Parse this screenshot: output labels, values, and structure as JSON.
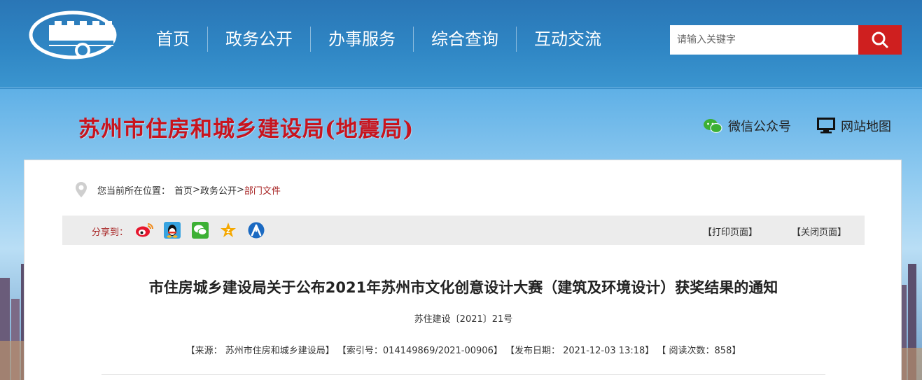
{
  "nav": {
    "items": [
      "首页",
      "政务公开",
      "办事服务",
      "综合查询",
      "互动交流"
    ]
  },
  "search": {
    "placeholder": "请输入关键字"
  },
  "site": {
    "title": "苏州市住房和城乡建设局(地震局)"
  },
  "quick_links": {
    "wechat": "微信公众号",
    "sitemap": "网站地图"
  },
  "breadcrumb": {
    "prefix": "您当前所在位置：",
    "items": [
      "首页",
      "政务公开",
      "部门文件"
    ],
    "separator": ">"
  },
  "share": {
    "label": "分享到：",
    "icons": [
      "weibo-icon",
      "qq-icon",
      "wechat-icon",
      "qzone-icon",
      "renren-icon"
    ],
    "print_label": "【打印页面】",
    "close_label": "【关闭页面】"
  },
  "article": {
    "title": "市住房城乡建设局关于公布2021年苏州市文化创意设计大赛（建筑及环境设计）获奖结果的通知",
    "doc_number": "苏住建设〔2021〕21号",
    "meta": "【来源： 苏州市住房和城乡建设局】 【索引号：014149869/2021-00906】 【发布日期： 2021-12-03 13:18】 【 阅读次数：858】"
  },
  "colors": {
    "header_blue": "#2f86c4",
    "search_red": "#cf1f1f",
    "title_red": "#c8141e",
    "wechat_green": "#3cb034"
  }
}
